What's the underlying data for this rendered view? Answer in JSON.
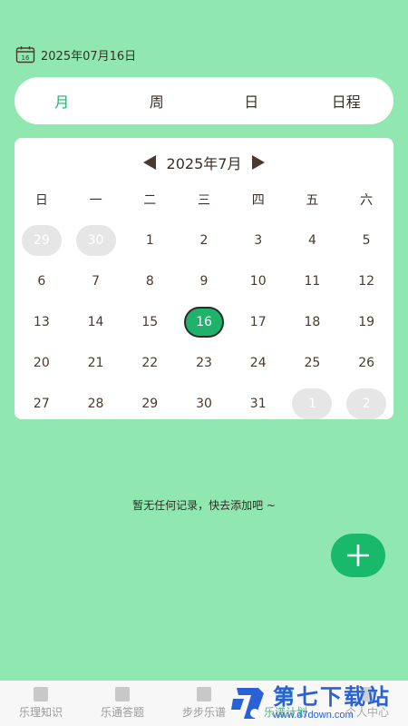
{
  "header": {
    "date_text": "2025年07月16日"
  },
  "view_tabs": [
    {
      "label": "月",
      "active": true
    },
    {
      "label": "周",
      "active": false
    },
    {
      "label": "日",
      "active": false
    },
    {
      "label": "日程",
      "active": false
    }
  ],
  "calendar": {
    "month_label": "2025年7月",
    "weekdays": [
      "日",
      "一",
      "二",
      "三",
      "四",
      "五",
      "六"
    ],
    "weeks": [
      [
        {
          "d": "29",
          "o": true
        },
        {
          "d": "30",
          "o": true
        },
        {
          "d": "1"
        },
        {
          "d": "2"
        },
        {
          "d": "3"
        },
        {
          "d": "4"
        },
        {
          "d": "5"
        }
      ],
      [
        {
          "d": "6"
        },
        {
          "d": "7"
        },
        {
          "d": "8"
        },
        {
          "d": "9"
        },
        {
          "d": "10"
        },
        {
          "d": "11"
        },
        {
          "d": "12"
        }
      ],
      [
        {
          "d": "13"
        },
        {
          "d": "14"
        },
        {
          "d": "15"
        },
        {
          "d": "16",
          "s": true
        },
        {
          "d": "17"
        },
        {
          "d": "18"
        },
        {
          "d": "19"
        }
      ],
      [
        {
          "d": "20"
        },
        {
          "d": "21"
        },
        {
          "d": "22"
        },
        {
          "d": "23"
        },
        {
          "d": "24"
        },
        {
          "d": "25"
        },
        {
          "d": "26"
        }
      ],
      [
        {
          "d": "27"
        },
        {
          "d": "28"
        },
        {
          "d": "29"
        },
        {
          "d": "30"
        },
        {
          "d": "31"
        },
        {
          "d": "1",
          "o": true
        },
        {
          "d": "2",
          "o": true
        }
      ]
    ]
  },
  "empty_message": "暂无任何记录，快去添加吧 ~",
  "add_button": {
    "icon": "plus-icon"
  },
  "bottom_nav": [
    {
      "label": "乐理知识",
      "icon": "music-theory-icon",
      "active": false
    },
    {
      "label": "乐通答题",
      "icon": "quiz-icon",
      "active": false
    },
    {
      "label": "步步乐谱",
      "icon": "sheet-music-icon",
      "active": false
    },
    {
      "label": "乐谱计划",
      "icon": "plan-icon",
      "active": true
    },
    {
      "label": "个人中心",
      "icon": "profile-icon",
      "active": false
    }
  ],
  "watermark": {
    "title": "第七下载站",
    "url": "www.d7down.com"
  },
  "colors": {
    "background": "#90e8b0",
    "accent": "#1fb26a",
    "fab": "#19b96a",
    "text": "#4a3a2e"
  }
}
